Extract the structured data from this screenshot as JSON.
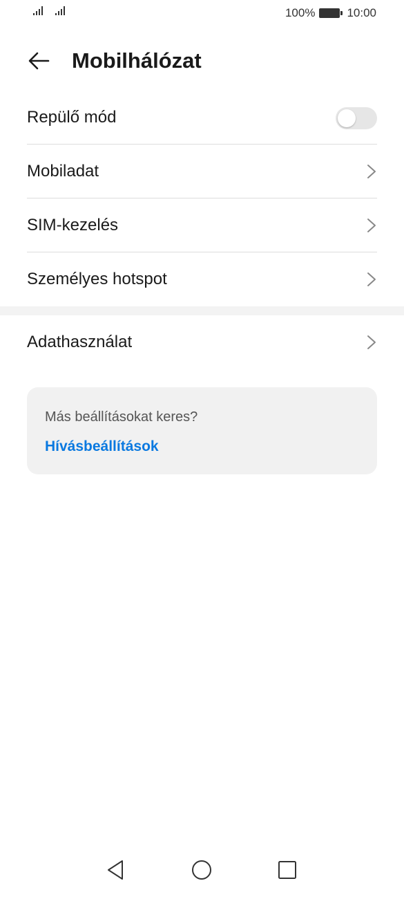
{
  "status_bar": {
    "battery_percent": "100%",
    "time": "10:00",
    "battery_icon": "battery-full-icon",
    "signal_icons": [
      "signal-icon",
      "signal-icon"
    ]
  },
  "header": {
    "title": "Mobilhálózat",
    "back_icon": "arrow-left-icon"
  },
  "settings": {
    "airplane_mode": {
      "label": "Repülő mód",
      "enabled": false
    },
    "items": [
      {
        "label": "Mobiladat",
        "icon": "chevron-right-icon"
      },
      {
        "label": "SIM-kezelés",
        "icon": "chevron-right-icon"
      },
      {
        "label": "Személyes hotspot",
        "icon": "chevron-right-icon"
      }
    ],
    "section2_items": [
      {
        "label": "Adathasználat",
        "icon": "chevron-right-icon"
      }
    ]
  },
  "suggestion_card": {
    "text": "Más beállításokat keres?",
    "link": "Hívásbeállítások"
  },
  "nav_bar": {
    "back_icon": "triangle-back-icon",
    "home_icon": "circle-home-icon",
    "recents_icon": "square-recents-icon"
  },
  "colors": {
    "accent": "#0a79e0",
    "divider": "#dcdcdc",
    "toggle_off": "#e6e6e6",
    "card_bg": "#f1f1f1"
  }
}
